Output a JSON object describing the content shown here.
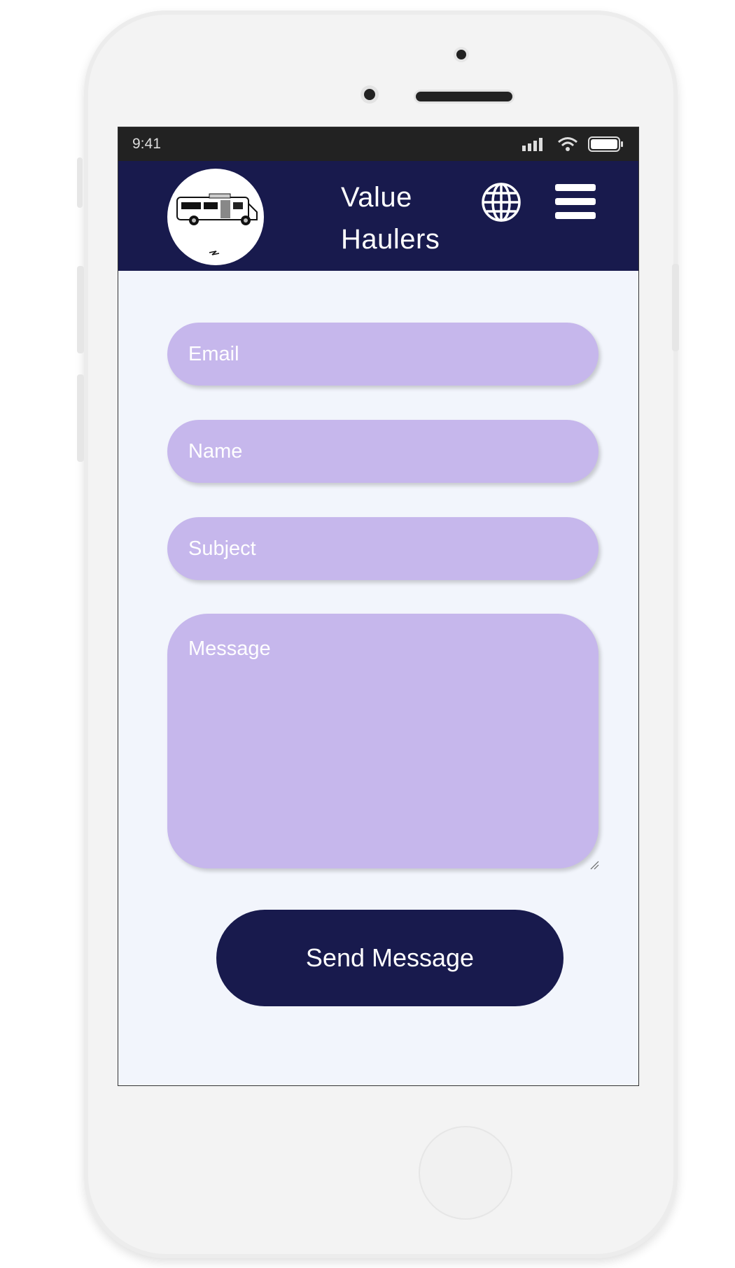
{
  "status_bar": {
    "time": "9:41"
  },
  "header": {
    "brand_line1": "Value",
    "brand_line2": "Haulers"
  },
  "form": {
    "email_placeholder": "Email",
    "name_placeholder": "Name",
    "subject_placeholder": "Subject",
    "message_placeholder": "Message",
    "send_label": "Send Message"
  },
  "colors": {
    "navbar": "#181a4d",
    "field_fill": "#c6b7ec",
    "page_background": "#f2f5fc",
    "button": "#181a4d"
  },
  "icons": {
    "logo": "van-logo",
    "language": "globe-icon",
    "menu": "hamburger-menu-icon",
    "signal": "cellular-signal-icon",
    "wifi": "wifi-icon",
    "battery": "battery-icon"
  }
}
